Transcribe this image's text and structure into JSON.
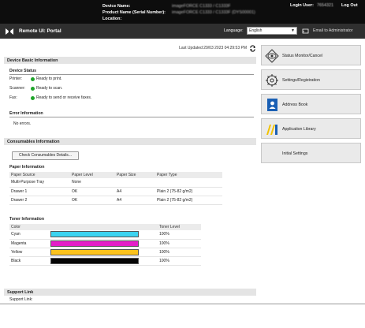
{
  "topbar": {
    "device_name_label": "Device Name:",
    "product_name_label": "Product Name (Serial Number):",
    "location_label": "Location:",
    "device_name_value": "imageFORCE C1333 / C1333F",
    "product_name_value": "imageFORCE C1333 / C1333F (DYS00001)",
    "login_user_label": "Login User:",
    "login_user_value": "7654321",
    "logout": "Log Out"
  },
  "navbar": {
    "title": "Remote UI: Portal",
    "language_label": "Language:",
    "language_value": "English",
    "admin_link": "Email to Administrator"
  },
  "last_updated": "Last Updated:29/03 2023 04:29:53 PM",
  "device_info": {
    "header": "Device Basic Information",
    "status_title": "Device Status",
    "statuses": [
      {
        "label": "Printer:",
        "text": "Ready to print."
      },
      {
        "label": "Scanner:",
        "text": "Ready to scan."
      },
      {
        "label": "Fax:",
        "text": "Ready to send or receive faxes."
      }
    ],
    "error_title": "Error Information",
    "error_text": "No errors."
  },
  "consumables": {
    "header": "Consumables Information",
    "button": "Check Consumables Details...",
    "paper_title": "Paper Information",
    "paper_columns": [
      "Paper Source",
      "Paper Level",
      "Paper Size",
      "Paper Type"
    ],
    "paper_rows": [
      [
        "Multi-Purpose Tray",
        "None",
        "",
        ""
      ],
      [
        "Drawer 1",
        "OK",
        "A4",
        "Plain 2 (75-82 g/m2)"
      ],
      [
        "Drawer 2",
        "OK",
        "A4",
        "Plain 2 (75-82 g/m2)"
      ]
    ],
    "toner_title": "Toner Information",
    "toner_columns": [
      "Color",
      "",
      "Toner Level"
    ],
    "toner_rows": [
      {
        "name": "Cyan",
        "level": "100%",
        "fill": 1.0,
        "color": "#3cd3f0"
      },
      {
        "name": "Magenta",
        "level": "100%",
        "fill": 1.0,
        "color": "#e51ec8"
      },
      {
        "name": "Yellow",
        "level": "100%",
        "fill": 1.0,
        "color": "#fbc21c"
      },
      {
        "name": "Black",
        "level": "100%",
        "fill": 1.0,
        "color": "#050505"
      }
    ]
  },
  "support": {
    "header": "Support Link",
    "label": "Support Link:"
  },
  "sidebar": [
    {
      "label": "Status Monitor/Cancel",
      "icon": "status-monitor-icon"
    },
    {
      "label": "Settings/Registration",
      "icon": "settings-icon"
    },
    {
      "label": "Address Book",
      "icon": "address-book-icon"
    },
    {
      "label": "Application Library",
      "icon": "application-library-icon"
    },
    {
      "label": "Initial Settings",
      "icon": ""
    }
  ],
  "colors": {
    "status_ok": "#1fa52b",
    "topbar": "#0d0d0d",
    "navbar": "#2f2f2f",
    "address_book_blue": "#1a5fb4",
    "app_library_yellow": "#f2c200"
  }
}
